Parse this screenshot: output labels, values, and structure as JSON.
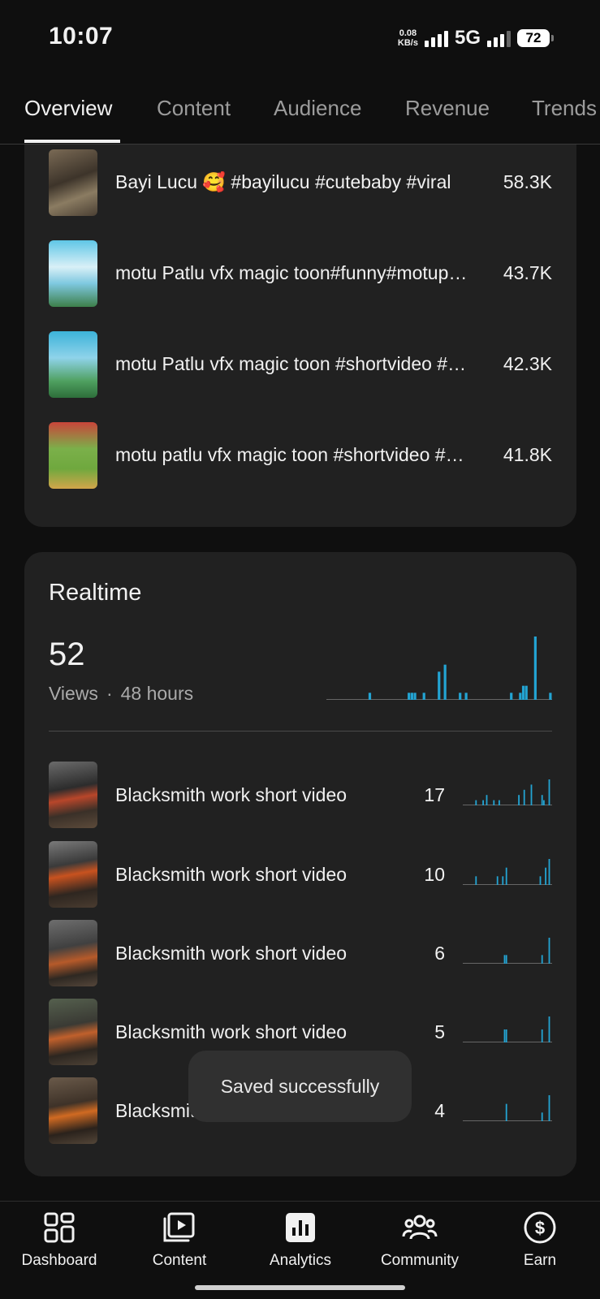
{
  "status_bar": {
    "time": "10:07",
    "net_speed_value": "0.08",
    "net_speed_unit": "KB/s",
    "network": "5G",
    "battery": "72"
  },
  "tabs": [
    {
      "label": "Overview",
      "active": true
    },
    {
      "label": "Content",
      "active": false
    },
    {
      "label": "Audience",
      "active": false
    },
    {
      "label": "Revenue",
      "active": false
    },
    {
      "label": "Trends",
      "active": false
    }
  ],
  "top_content": [
    {
      "title": "Bayi Lucu 🥰 #bayilucu #cutebaby #viral",
      "views": "58.3K"
    },
    {
      "title": "motu Patlu vfx magic toon#funny#motupatlu",
      "views": "43.7K"
    },
    {
      "title": "motu Patlu vfx magic toon #shortvideo #viral",
      "views": "42.3K"
    },
    {
      "title": "motu patlu vfx magic toon #shortvideo #viral",
      "views": "41.8K"
    }
  ],
  "realtime": {
    "title": "Realtime",
    "count": "52",
    "metric": "Views",
    "separator": "·",
    "period": "48 hours",
    "chart_data": {
      "type": "bar",
      "values": [
        0,
        0,
        0,
        0,
        0,
        0,
        0,
        0,
        0,
        0,
        0,
        0,
        0,
        0,
        1,
        0,
        0,
        0,
        0,
        0,
        0,
        0,
        0,
        0,
        0,
        0,
        0,
        1,
        1,
        1,
        0,
        0,
        1,
        0,
        0,
        0,
        0,
        4,
        0,
        5,
        0,
        0,
        0,
        0,
        1,
        0,
        1,
        0,
        0,
        0,
        0,
        0,
        0,
        0,
        0,
        0,
        0,
        0,
        0,
        0,
        0,
        1,
        0,
        0,
        1,
        2,
        2,
        0,
        0,
        9,
        0,
        0,
        0,
        0,
        1
      ]
    },
    "items": [
      {
        "title": "Blacksmith work short video",
        "views": "17",
        "spark": [
          0,
          0,
          0,
          0,
          0,
          0,
          0,
          1,
          0,
          0,
          0,
          1,
          0,
          2,
          0,
          0,
          0,
          1,
          0,
          0,
          1,
          0,
          0,
          0,
          0,
          0,
          0,
          0,
          0,
          0,
          0,
          2,
          0,
          0,
          3,
          0,
          0,
          0,
          4,
          0,
          0,
          0,
          0,
          0,
          2,
          1,
          0,
          0,
          5,
          0
        ]
      },
      {
        "title": "Blacksmith work short video",
        "views": "10",
        "spark": [
          0,
          0,
          0,
          0,
          0,
          0,
          0,
          1,
          0,
          0,
          0,
          0,
          0,
          0,
          0,
          0,
          0,
          0,
          0,
          1,
          0,
          0,
          1,
          0,
          2,
          0,
          0,
          0,
          0,
          0,
          0,
          0,
          0,
          0,
          0,
          0,
          0,
          0,
          0,
          0,
          0,
          0,
          0,
          1,
          0,
          0,
          2,
          0,
          3,
          0
        ]
      },
      {
        "title": "Blacksmith work short video",
        "views": "6",
        "spark": [
          0,
          0,
          0,
          0,
          0,
          0,
          0,
          0,
          0,
          0,
          0,
          0,
          0,
          0,
          0,
          0,
          0,
          0,
          0,
          0,
          0,
          0,
          0,
          1,
          1,
          0,
          0,
          0,
          0,
          0,
          0,
          0,
          0,
          0,
          0,
          0,
          0,
          0,
          0,
          0,
          0,
          0,
          0,
          0,
          1,
          0,
          0,
          0,
          3,
          0
        ]
      },
      {
        "title": "Blacksmith work short video",
        "views": "5",
        "spark": [
          0,
          0,
          0,
          0,
          0,
          0,
          0,
          0,
          0,
          0,
          0,
          0,
          0,
          0,
          0,
          0,
          0,
          0,
          0,
          0,
          0,
          0,
          0,
          1,
          1,
          0,
          0,
          0,
          0,
          0,
          0,
          0,
          0,
          0,
          0,
          0,
          0,
          0,
          0,
          0,
          0,
          0,
          0,
          0,
          1,
          0,
          0,
          0,
          2,
          0
        ]
      },
      {
        "title": "Blacksmith work short video",
        "views": "4",
        "spark": [
          0,
          0,
          0,
          0,
          0,
          0,
          0,
          0,
          0,
          0,
          0,
          0,
          0,
          0,
          0,
          0,
          0,
          0,
          0,
          0,
          0,
          0,
          0,
          0,
          2,
          0,
          0,
          0,
          0,
          0,
          0,
          0,
          0,
          0,
          0,
          0,
          0,
          0,
          0,
          0,
          0,
          0,
          0,
          0,
          1,
          0,
          0,
          0,
          3,
          0
        ]
      }
    ]
  },
  "toast": "Saved successfully",
  "bottom_nav": [
    {
      "label": "Dashboard",
      "icon": "dashboard-icon"
    },
    {
      "label": "Content",
      "icon": "content-icon"
    },
    {
      "label": "Analytics",
      "icon": "analytics-icon",
      "active": true
    },
    {
      "label": "Community",
      "icon": "community-icon"
    },
    {
      "label": "Earn",
      "icon": "earn-icon"
    }
  ],
  "colors": {
    "background": "#0f0f0f",
    "card": "#212121",
    "chart_bar": "#23a4d3",
    "text_secondary": "#aaaaaa"
  }
}
